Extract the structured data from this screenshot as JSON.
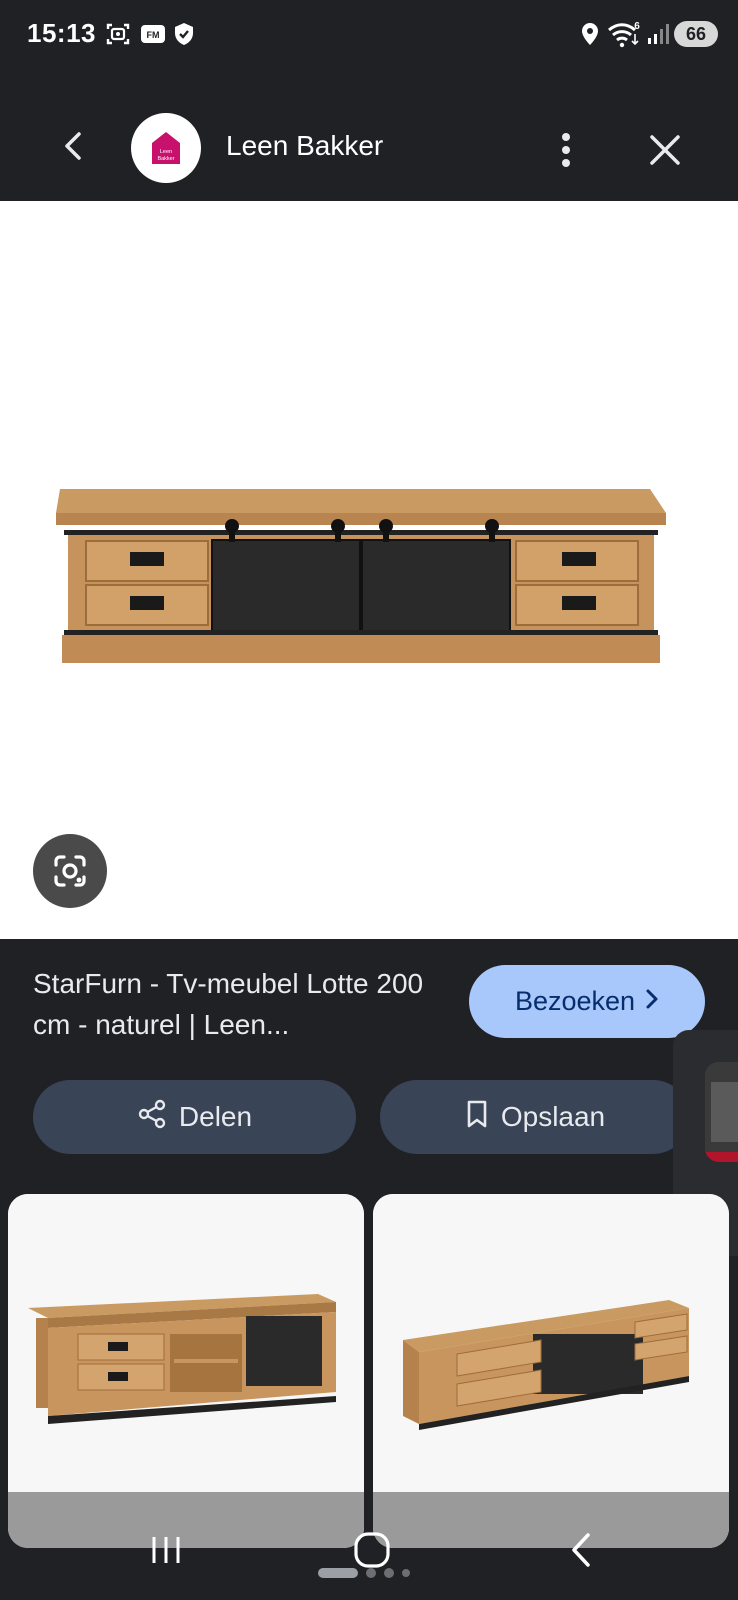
{
  "status_bar": {
    "time": "15:13",
    "network_badge": "6",
    "battery": "66"
  },
  "header": {
    "site_name": "Leen Bakker",
    "logo_text": "Leen Bakker"
  },
  "product": {
    "title": "StarFurn - Tv-meubel Lotte 200 cm - naturel | Leen...",
    "visit_label": "Bezoeken"
  },
  "actions": {
    "share_label": "Delen",
    "save_label": "Opslaan"
  },
  "icons": {
    "back": "back-arrow-icon",
    "more": "more-vert-icon",
    "close": "close-icon",
    "lens": "google-lens-icon",
    "share": "share-icon",
    "bookmark": "bookmark-icon",
    "chevron": "chevron-right-icon"
  },
  "colors": {
    "background": "#202124",
    "visit_button": "#a8c7fa",
    "action_button": "#394457",
    "brand": "#c8116d"
  }
}
